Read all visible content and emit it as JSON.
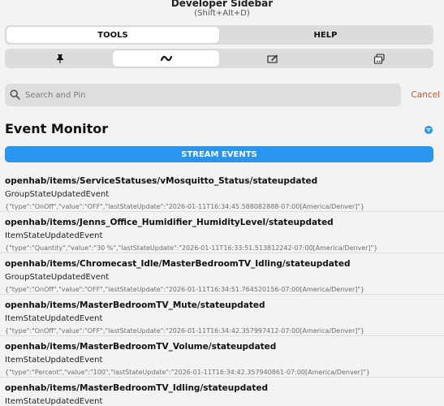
{
  "header": {
    "title": "Developer Sidebar",
    "subtitle": "(Shift+Alt+D)"
  },
  "tabs": [
    {
      "label": "TOOLS",
      "active": true
    },
    {
      "label": "HELP",
      "active": false
    }
  ],
  "icon_tabs": [
    {
      "icon": "pin-icon",
      "active": false
    },
    {
      "icon": "activity-icon",
      "active": true
    },
    {
      "icon": "edit-box-icon",
      "active": false
    },
    {
      "icon": "stack-icon",
      "active": false
    }
  ],
  "search": {
    "placeholder": "Search and Pin",
    "value": "",
    "cancel_label": "Cancel"
  },
  "monitor": {
    "title": "Event Monitor",
    "stream_label": "STREAM EVENTS"
  },
  "colors": {
    "accent": "#2a95ef",
    "cancel": "#d6502b"
  },
  "events": [
    {
      "topic": "openhab/items/ServiceStatuses/vMosquitto_Status/stateupdated",
      "type": "GroupStateUpdatedEvent",
      "payload": "{\"type\":\"OnOff\",\"value\":\"OFF\",\"lastStateUpdate\":\"2026-01-11T16:34:45.588082888-07:00[America/Denver]\"}"
    },
    {
      "topic": "openhab/items/Jenns_Office_Humidifier_HumidityLevel/stateupdated",
      "type": "ItemStateUpdatedEvent",
      "payload": "{\"type\":\"Quantity\",\"value\":\"30 %\",\"lastStateUpdate\":\"2026-01-11T16:33:51.513812242-07:00[America/Denver]\"}"
    },
    {
      "topic": "openhab/items/Chromecast_Idle/MasterBedroomTV_Idling/stateupdated",
      "type": "GroupStateUpdatedEvent",
      "payload": "{\"type\":\"OnOff\",\"value\":\"OFF\",\"lastStateUpdate\":\"2026-01-11T16:34:51.764520156-07:00[America/Denver]\"}"
    },
    {
      "topic": "openhab/items/MasterBedroomTV_Mute/stateupdated",
      "type": "ItemStateUpdatedEvent",
      "payload": "{\"type\":\"OnOff\",\"value\":\"OFF\",\"lastStateUpdate\":\"2026-01-11T16:34:42.357997412-07:00[America/Denver]\"}"
    },
    {
      "topic": "openhab/items/MasterBedroomTV_Volume/stateupdated",
      "type": "ItemStateUpdatedEvent",
      "payload": "{\"type\":\"Percent\",\"value\":\"100\",\"lastStateUpdate\":\"2026-01-11T16:34:42.357940861-07:00[America/Denver]\"}"
    },
    {
      "topic": "openhab/items/MasterBedroomTV_Idling/stateupdated",
      "type": "ItemStateUpdatedEvent",
      "payload": ""
    }
  ]
}
